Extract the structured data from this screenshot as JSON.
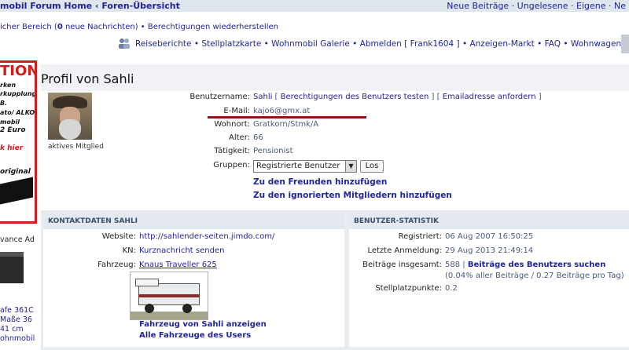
{
  "topnav": {
    "breadcrumb_left": "mobil Forum Home ‹ Foren-Übersicht",
    "links_right": "Neue Beiträge · Ungelesene · Eigene · Ne"
  },
  "row2": {
    "text_prefix": "icher Bereich (",
    "count": "0",
    "text_suffix": " neue Nachrichten) • Berechtigungen wiederherstellen"
  },
  "row3": {
    "items": "Reiseberichte • Stellplatzkarte • Wohnmobil Galerie • Abmelden [ Frank1604 ] • Anzeigen-Markt • FAQ • Wohnwagen Forum •"
  },
  "ad": {
    "headline": "TION",
    "lines": [
      "rken",
      "rkupplung",
      "B.",
      "ato/ ALKO",
      "mobil",
      "2 Euro"
    ],
    "cta": "k hier",
    "original": "original",
    "label": "vance Ad",
    "text_lines": [
      "afe 361C",
      "Maße 36",
      "41 cm",
      "ohnmobil"
    ]
  },
  "page": {
    "title": "Profil von Sahli"
  },
  "profile": {
    "status": "aktives Mitglied",
    "fields": {
      "username_label": "Benutzername:",
      "username": "Sahli",
      "test_perms": "Berechtigungen des Benutzers testen",
      "request_email": "Emailadresse anfordern",
      "email_label": "E-Mail:",
      "email": "kajo6@gmx.at",
      "location_label": "Wohnort:",
      "location": "Gratkorn/Stmk/A",
      "age_label": "Alter:",
      "age": "66",
      "job_label": "Tätigkeit:",
      "job": "Pensionist",
      "groups_label": "Gruppen:",
      "group_selected": "Registrierte Benutzer",
      "go_button": "Los"
    },
    "add_friend": "Zu den Freunden hinzufügen",
    "add_ignored": "Zu den ignorierten Mitgliedern hinzufügen"
  },
  "contact": {
    "header": "KONTAKTDATEN SAHLI",
    "website_label": "Website:",
    "website": "http://sahlender-seiten.jimdo.com/",
    "kn_label": "KN:",
    "kn": "Kurznachricht senden",
    "vehicle_label": "Fahrzeug:",
    "vehicle": "Knaus Traveller 625",
    "show_vehicle": "Fahrzeug von Sahli anzeigen",
    "all_vehicles": "Alle Fahrzeuge des Users"
  },
  "stats": {
    "header": "BENUTZER-STATISTIK",
    "registered_label": "Registriert:",
    "registered": "06 Aug 2007 16:50:25",
    "last_login_label": "Letzte Anmeldung:",
    "last_login": "29 Aug 2013 21:49:14",
    "posts_label": "Beiträge insgesamt:",
    "posts": "588",
    "search_posts": "Beiträge des Benutzers suchen",
    "posts_pct": "(0.04% aller Beiträge / 0.27 Beiträge pro Tag)",
    "points_label": "Stellplatzpunkte:",
    "points": "0.2"
  },
  "colors": {
    "link": "#22229C",
    "accent_red": "#8b1a1a",
    "panel_bg": "#e8ebef"
  }
}
